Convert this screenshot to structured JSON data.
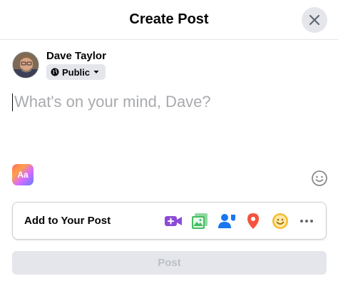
{
  "dialog": {
    "title": "Create Post",
    "close_icon": "close-icon"
  },
  "user": {
    "name": "Dave Taylor",
    "privacy_label": "Public",
    "privacy_icon": "globe-icon",
    "dropdown_icon": "caret-down-icon"
  },
  "composer": {
    "placeholder": "What's on your mind, Dave?",
    "value": "",
    "text_background_label": "Aa",
    "emoji_icon": "smiley-icon"
  },
  "add_to_post": {
    "label": "Add to Your Post",
    "tools": [
      {
        "name": "live-video",
        "icon": "video-plus-icon",
        "color": "#8c4bd6"
      },
      {
        "name": "photo-video",
        "icon": "photo-icon",
        "color": "#45bd62"
      },
      {
        "name": "tag-people",
        "icon": "tag-people-icon",
        "color": "#1877f2"
      },
      {
        "name": "check-in",
        "icon": "location-pin-icon",
        "color": "#f5533d"
      },
      {
        "name": "feeling-activity",
        "icon": "smiley-icon",
        "color": "#f7b928"
      },
      {
        "name": "more",
        "icon": "more-dots-icon",
        "color": "#65676b"
      }
    ]
  },
  "actions": {
    "post_label": "Post"
  }
}
